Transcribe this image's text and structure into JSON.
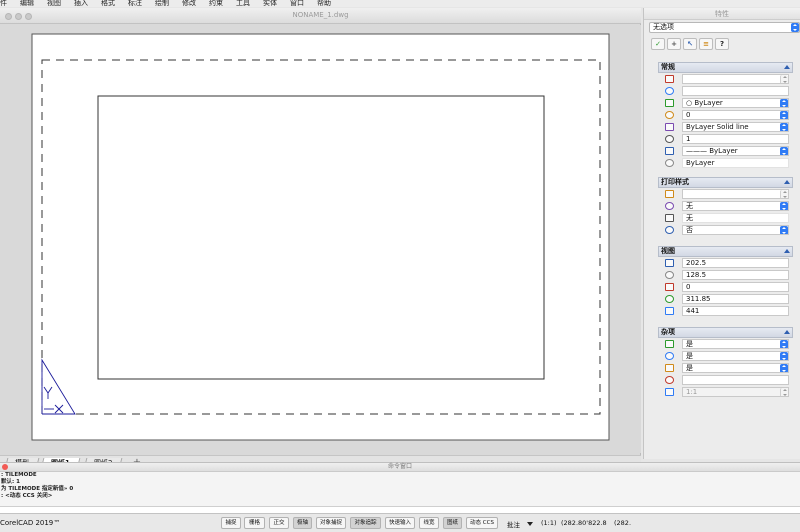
{
  "menubar": {
    "items": [
      "件",
      "编辑",
      "视图",
      "插入",
      "格式",
      "标注",
      "绘制",
      "修改",
      "约束",
      "工具",
      "实体",
      "窗口",
      "帮助"
    ]
  },
  "drawing_window": {
    "title": "NONAME_1.dwg",
    "tabs": [
      "模型",
      "图纸1",
      "图纸2"
    ],
    "active_tab": "图纸1",
    "add_tab": "+"
  },
  "properties_panel": {
    "title": "特性",
    "selection": "无选项",
    "tool_buttons": [
      "✓",
      "+",
      "↖",
      "≡",
      "?"
    ],
    "sections": [
      {
        "title": "常规",
        "rows": [
          {
            "icon": "color-icon",
            "value": "",
            "control": "stepper-gray"
          },
          {
            "icon": "layer-icon",
            "value": "",
            "control": "none"
          },
          {
            "icon": "color-fill-icon",
            "value": "○ ByLayer",
            "control": "stepper"
          },
          {
            "icon": "layer-stack-icon",
            "value": "0",
            "control": "stepper"
          },
          {
            "icon": "linetype-icon",
            "value": "ByLayer     Solid line",
            "control": "stepper"
          },
          {
            "icon": "linescale-icon",
            "value": "1",
            "control": "none"
          },
          {
            "icon": "lineweight-icon",
            "value": "——— ByLayer",
            "control": "stepper"
          },
          {
            "icon": "transparency-icon",
            "value": "ByLayer",
            "control": "plain"
          }
        ]
      },
      {
        "title": "打印样式",
        "rows": [
          {
            "icon": "print-color-icon",
            "value": "",
            "control": "stepper-gray"
          },
          {
            "icon": "print-style-icon",
            "value": "无",
            "control": "stepper"
          },
          {
            "icon": "print-table-icon",
            "value": "无",
            "control": "plain"
          },
          {
            "icon": "print-attach-icon",
            "value": "否",
            "control": "stepper"
          }
        ]
      },
      {
        "title": "视图",
        "rows": [
          {
            "icon": "center-x-icon",
            "value": "202.5",
            "control": "none"
          },
          {
            "icon": "center-y-icon",
            "value": "128.5",
            "control": "none"
          },
          {
            "icon": "center-z-icon",
            "value": "0",
            "control": "none"
          },
          {
            "icon": "height-icon",
            "value": "311.85",
            "control": "none"
          },
          {
            "icon": "width-icon",
            "value": "441",
            "control": "none"
          }
        ]
      },
      {
        "title": "杂项",
        "rows": [
          {
            "icon": "ucs-on-icon",
            "value": "是",
            "control": "stepper"
          },
          {
            "icon": "ucs-origin-icon",
            "value": "是",
            "control": "stepper"
          },
          {
            "icon": "ucs-per-viewport-icon",
            "value": "是",
            "control": "stepper"
          },
          {
            "icon": "ucs-name-icon",
            "value": "",
            "control": "none"
          },
          {
            "icon": "annotation-scale-icon",
            "value": "1:1",
            "control": "stepper-gray-disabled"
          }
        ]
      }
    ]
  },
  "command_window": {
    "title": "命令窗口",
    "lines": [
      ": TILEMODE",
      "默认: 1",
      "为 TILEMODE 指定新值» 0",
      ": <动态 CCS 关闭>"
    ]
  },
  "statusbar": {
    "app_name": "CorelCAD 2019™",
    "buttons": [
      {
        "label": "捕捉",
        "on": false
      },
      {
        "label": "栅格",
        "on": false
      },
      {
        "label": "正交",
        "on": false
      },
      {
        "label": "极轴",
        "on": true
      },
      {
        "label": "对象捕捉",
        "on": false
      },
      {
        "label": "对象追踪",
        "on": true
      },
      {
        "label": "快速输入",
        "on": false
      },
      {
        "label": "线宽",
        "on": false
      },
      {
        "label": "图纸",
        "on": true
      },
      {
        "label": "动态 CCS",
        "on": false
      }
    ],
    "annotation_label": "批注",
    "scale": "(1:1)",
    "coords": "(282.80'822.8",
    "coords2": "(282."
  }
}
